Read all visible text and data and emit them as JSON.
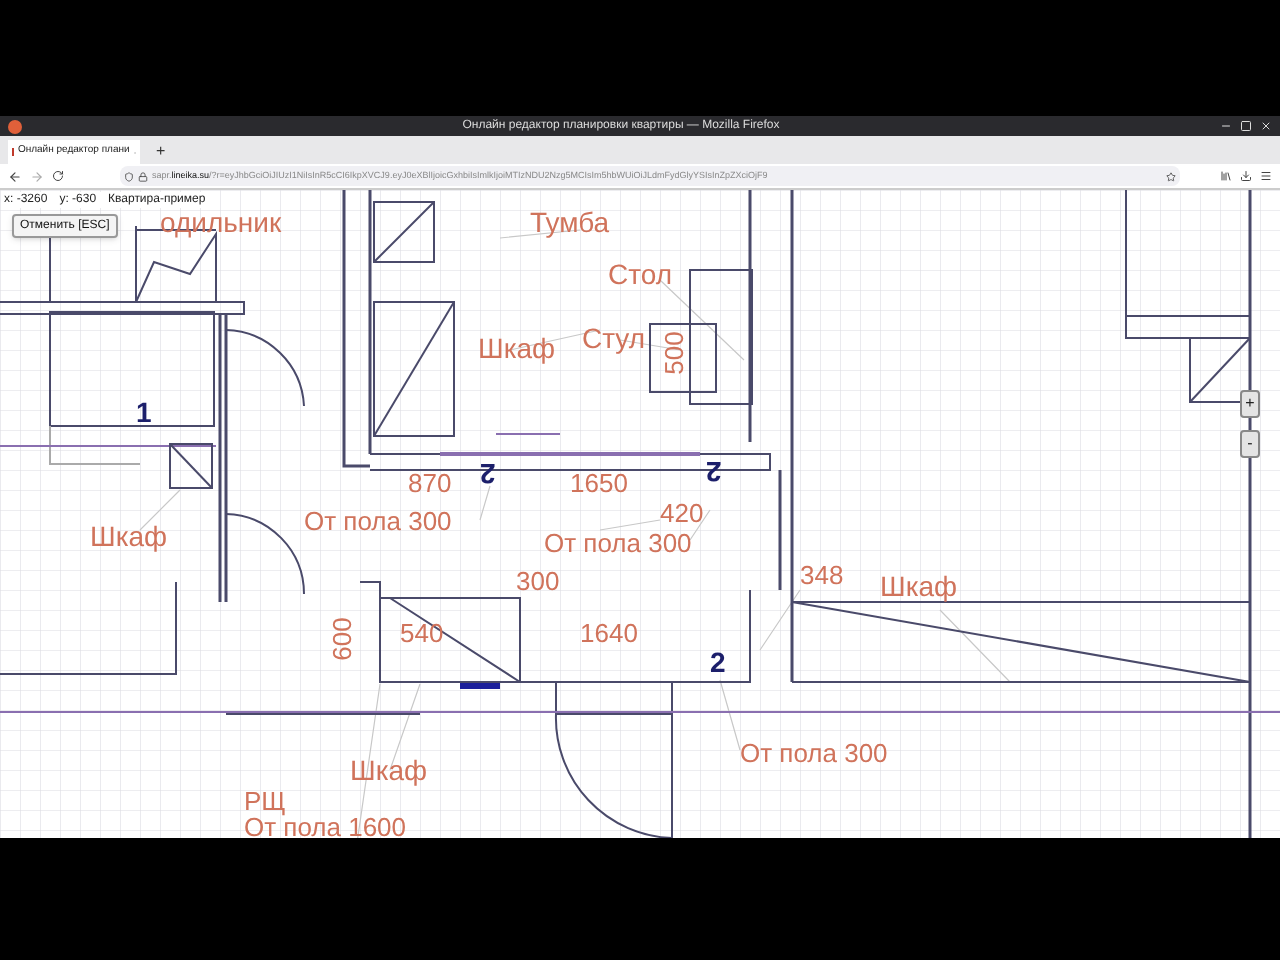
{
  "window": {
    "title": "Онлайн редактор планировки квартиры — Mozilla Firefox"
  },
  "tabs": [
    {
      "label": "Онлайн редактор плани",
      "selected": true
    }
  ],
  "new_tab_button": "+",
  "address_bar": {
    "domain_prefix": "sapr.",
    "domain": "lineika.su",
    "path": "/?r=eyJhbGciOiJIUzI1NiIsInR5cCI6IkpXVCJ9.eyJ0eXBlIjoicGxhbiIsImlkIjoiMTIzNDU2Nzg5MCIsIm5hbWUiOiJLdmFydGlyYSIsInZpZXciOjF9"
  },
  "toolbar": {
    "x": "x: -3260",
    "y": "y: -630",
    "project": "Квартира-пример",
    "undo_button": "Отменить [ESC]"
  },
  "plan": {
    "labels": [
      {
        "text": "одильник",
        "kind": "furniture"
      },
      {
        "text": "Тумба",
        "kind": "furniture"
      },
      {
        "text": "Стол",
        "kind": "furniture"
      },
      {
        "text": "Стул",
        "kind": "furniture"
      },
      {
        "text": "500",
        "kind": "dimension"
      },
      {
        "text": "Шкаф",
        "kind": "furniture"
      },
      {
        "text": "1",
        "kind": "marker"
      },
      {
        "text": "870",
        "kind": "dimension"
      },
      {
        "text": "2",
        "kind": "marker"
      },
      {
        "text": "1650",
        "kind": "dimension"
      },
      {
        "text": "2",
        "kind": "marker"
      },
      {
        "text": "420",
        "kind": "dimension"
      },
      {
        "text": "От пола 300",
        "kind": "note"
      },
      {
        "text": "От пола 300",
        "kind": "note"
      },
      {
        "text": "Шкаф",
        "kind": "furniture"
      },
      {
        "text": "300",
        "kind": "dimension"
      },
      {
        "text": "348",
        "kind": "dimension"
      },
      {
        "text": "Шкаф",
        "kind": "furniture"
      },
      {
        "text": "540",
        "kind": "dimension"
      },
      {
        "text": "1640",
        "kind": "dimension"
      },
      {
        "text": "600",
        "kind": "dimension"
      },
      {
        "text": "2",
        "kind": "marker"
      },
      {
        "text": "От пола 300",
        "kind": "note"
      },
      {
        "text": "Шкаф",
        "kind": "furniture"
      },
      {
        "text": "РЩ",
        "kind": "note"
      },
      {
        "text": "От пола 1600",
        "kind": "note"
      }
    ]
  },
  "zoom_controls": [
    "+",
    "-"
  ]
}
